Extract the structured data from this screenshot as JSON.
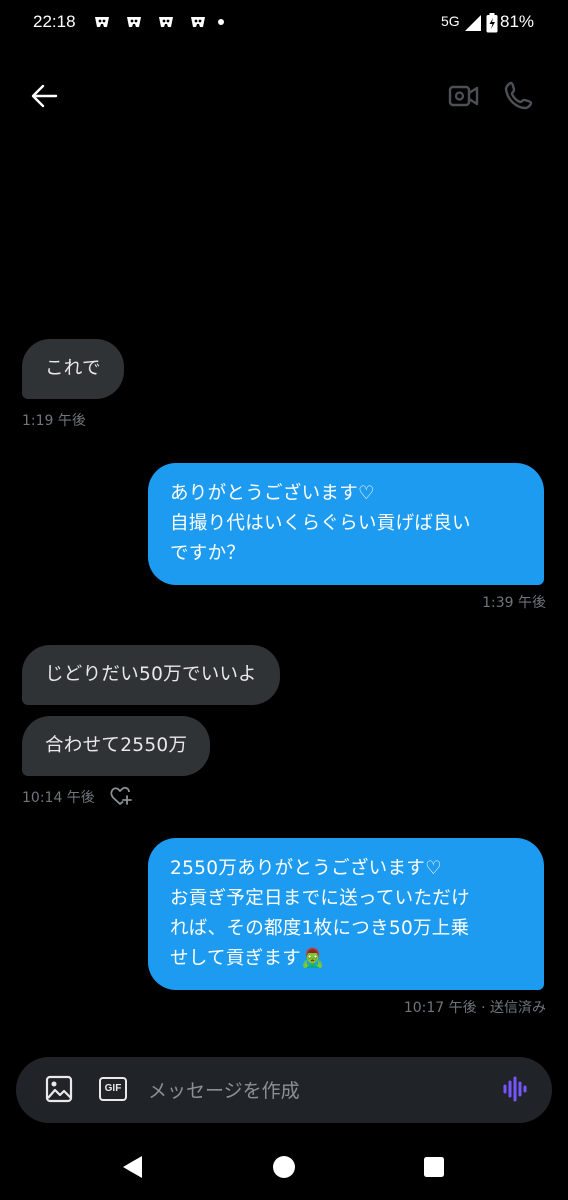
{
  "status": {
    "time": "22:18",
    "network": "5G",
    "battery": "81%"
  },
  "header": {
    "back_icon": "arrow-left-icon",
    "video_icon": "video-call-icon",
    "phone_icon": "phone-icon"
  },
  "messages": [
    {
      "direction": "received",
      "text": "これで"
    },
    {
      "direction": "received_meta",
      "time": "1:19 午後"
    },
    {
      "direction": "sent",
      "text": "ありがとうございます♡\n自撮り代はいくらぐらい貢げば良い\nですか？"
    },
    {
      "direction": "sent_meta",
      "time": "1:39 午後"
    },
    {
      "direction": "received",
      "text": "じどりだい50万でいいよ"
    },
    {
      "direction": "received",
      "text": "合わせて2550万"
    },
    {
      "direction": "received_meta",
      "time": "10:14 午後"
    },
    {
      "direction": "sent",
      "text": "2550万ありがとうございます♡\nお貢ぎ予定日までに送っていただけ\nれば、その都度1枚につき50万上乗\nせして貢ぎます🧟‍♂️"
    },
    {
      "direction": "sent_meta",
      "time": "10:17 午後 · 送信済み"
    }
  ],
  "composer": {
    "placeholder": "メッセージを作成",
    "image_icon": "image-icon",
    "gif_label": "GIF",
    "voice_icon": "voice-waveform-icon"
  },
  "colors": {
    "sent_bubble": "#1d9bf0",
    "received_bubble": "#2f3336",
    "voice_accent": "#7856ff"
  }
}
